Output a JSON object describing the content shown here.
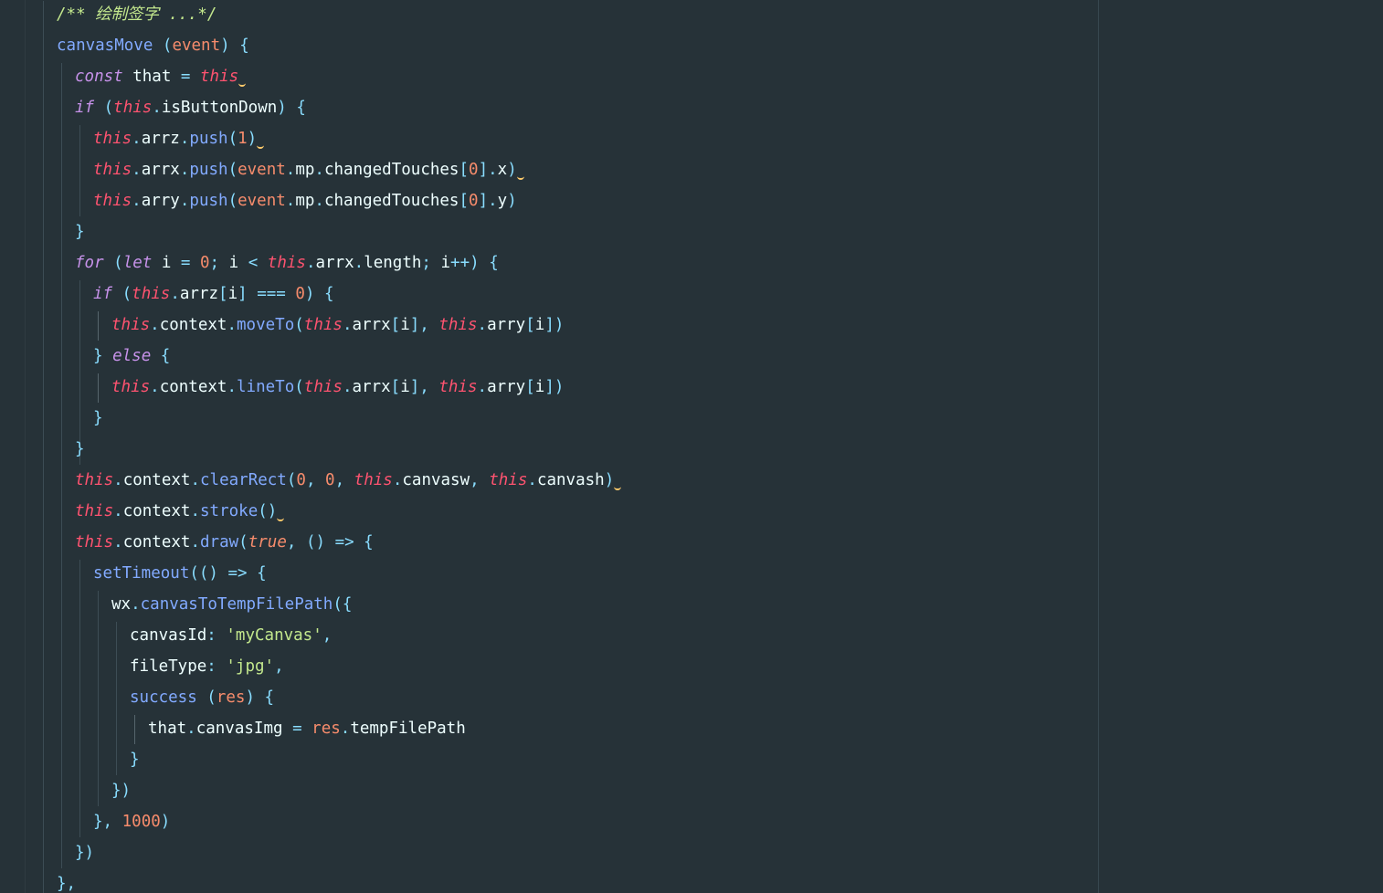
{
  "editor": {
    "lines": [
      {
        "indent": 62,
        "tokens": [
          {
            "t": "/** 绘制签字 ...*/",
            "c": "comment"
          }
        ]
      },
      {
        "indent": 62,
        "tokens": [
          {
            "t": "canvasMove",
            "c": "fn"
          },
          {
            "t": " ",
            "c": "var"
          },
          {
            "t": "(",
            "c": "punct"
          },
          {
            "t": "event",
            "c": "param"
          },
          {
            "t": ")",
            "c": "punct"
          },
          {
            "t": " {",
            "c": "punct"
          }
        ]
      },
      {
        "indent": 82,
        "tokens": [
          {
            "t": "const",
            "c": "kw"
          },
          {
            "t": " that ",
            "c": "var"
          },
          {
            "t": "=",
            "c": "punct"
          },
          {
            "t": " ",
            "c": "var"
          },
          {
            "t": "this",
            "c": "this"
          },
          {
            "t": "",
            "c": "squiggle"
          }
        ]
      },
      {
        "indent": 82,
        "tokens": [
          {
            "t": "if",
            "c": "kw"
          },
          {
            "t": " (",
            "c": "punct"
          },
          {
            "t": "this",
            "c": "this"
          },
          {
            "t": ".",
            "c": "punct"
          },
          {
            "t": "isButtonDown",
            "c": "var"
          },
          {
            "t": ")",
            "c": "punct"
          },
          {
            "t": " {",
            "c": "punct"
          }
        ]
      },
      {
        "indent": 102,
        "tokens": [
          {
            "t": "this",
            "c": "this"
          },
          {
            "t": ".",
            "c": "punct"
          },
          {
            "t": "arrz",
            "c": "var"
          },
          {
            "t": ".",
            "c": "punct"
          },
          {
            "t": "push",
            "c": "fn"
          },
          {
            "t": "(",
            "c": "punct"
          },
          {
            "t": "1",
            "c": "num"
          },
          {
            "t": ")",
            "c": "punct"
          },
          {
            "t": "",
            "c": "squiggle"
          }
        ]
      },
      {
        "indent": 102,
        "tokens": [
          {
            "t": "this",
            "c": "this"
          },
          {
            "t": ".",
            "c": "punct"
          },
          {
            "t": "arrx",
            "c": "var"
          },
          {
            "t": ".",
            "c": "punct"
          },
          {
            "t": "push",
            "c": "fn"
          },
          {
            "t": "(",
            "c": "punct"
          },
          {
            "t": "event",
            "c": "param"
          },
          {
            "t": ".",
            "c": "punct"
          },
          {
            "t": "mp",
            "c": "var"
          },
          {
            "t": ".",
            "c": "punct"
          },
          {
            "t": "changedTouches",
            "c": "var"
          },
          {
            "t": "[",
            "c": "punct"
          },
          {
            "t": "0",
            "c": "num"
          },
          {
            "t": "].",
            "c": "punct"
          },
          {
            "t": "x",
            "c": "var"
          },
          {
            "t": ")",
            "c": "punct"
          },
          {
            "t": "",
            "c": "squiggle"
          }
        ]
      },
      {
        "indent": 102,
        "tokens": [
          {
            "t": "this",
            "c": "this"
          },
          {
            "t": ".",
            "c": "punct"
          },
          {
            "t": "arry",
            "c": "var"
          },
          {
            "t": ".",
            "c": "punct"
          },
          {
            "t": "push",
            "c": "fn"
          },
          {
            "t": "(",
            "c": "punct"
          },
          {
            "t": "event",
            "c": "param"
          },
          {
            "t": ".",
            "c": "punct"
          },
          {
            "t": "mp",
            "c": "var"
          },
          {
            "t": ".",
            "c": "punct"
          },
          {
            "t": "changedTouches",
            "c": "var"
          },
          {
            "t": "[",
            "c": "punct"
          },
          {
            "t": "0",
            "c": "num"
          },
          {
            "t": "].",
            "c": "punct"
          },
          {
            "t": "y",
            "c": "var"
          },
          {
            "t": ")",
            "c": "punct"
          }
        ]
      },
      {
        "indent": 82,
        "tokens": [
          {
            "t": "}",
            "c": "punct"
          }
        ]
      },
      {
        "indent": 82,
        "tokens": [
          {
            "t": "for",
            "c": "kw"
          },
          {
            "t": " (",
            "c": "punct"
          },
          {
            "t": "let",
            "c": "kw"
          },
          {
            "t": " i ",
            "c": "var"
          },
          {
            "t": "=",
            "c": "punct"
          },
          {
            "t": " ",
            "c": "var"
          },
          {
            "t": "0",
            "c": "num"
          },
          {
            "t": ";",
            "c": "punct"
          },
          {
            "t": " i ",
            "c": "var"
          },
          {
            "t": "<",
            "c": "punct"
          },
          {
            "t": " ",
            "c": "var"
          },
          {
            "t": "this",
            "c": "this"
          },
          {
            "t": ".",
            "c": "punct"
          },
          {
            "t": "arrx",
            "c": "var"
          },
          {
            "t": ".",
            "c": "punct"
          },
          {
            "t": "length",
            "c": "var"
          },
          {
            "t": ";",
            "c": "punct"
          },
          {
            "t": " i",
            "c": "var"
          },
          {
            "t": "++",
            "c": "punct"
          },
          {
            "t": ")",
            "c": "punct"
          },
          {
            "t": " {",
            "c": "punct"
          }
        ]
      },
      {
        "indent": 102,
        "tokens": [
          {
            "t": "if",
            "c": "kw"
          },
          {
            "t": " (",
            "c": "punct"
          },
          {
            "t": "this",
            "c": "this"
          },
          {
            "t": ".",
            "c": "punct"
          },
          {
            "t": "arrz",
            "c": "var"
          },
          {
            "t": "[",
            "c": "punct"
          },
          {
            "t": "i",
            "c": "var"
          },
          {
            "t": "]",
            "c": "punct"
          },
          {
            "t": " === ",
            "c": "punct"
          },
          {
            "t": "0",
            "c": "num"
          },
          {
            "t": ")",
            "c": "punct"
          },
          {
            "t": " {",
            "c": "punct"
          }
        ]
      },
      {
        "indent": 122,
        "tokens": [
          {
            "t": "this",
            "c": "this"
          },
          {
            "t": ".",
            "c": "punct"
          },
          {
            "t": "context",
            "c": "var"
          },
          {
            "t": ".",
            "c": "punct"
          },
          {
            "t": "moveTo",
            "c": "fn"
          },
          {
            "t": "(",
            "c": "punct"
          },
          {
            "t": "this",
            "c": "this"
          },
          {
            "t": ".",
            "c": "punct"
          },
          {
            "t": "arrx",
            "c": "var"
          },
          {
            "t": "[",
            "c": "punct"
          },
          {
            "t": "i",
            "c": "var"
          },
          {
            "t": "],",
            "c": "punct"
          },
          {
            "t": " ",
            "c": "var"
          },
          {
            "t": "this",
            "c": "this"
          },
          {
            "t": ".",
            "c": "punct"
          },
          {
            "t": "arry",
            "c": "var"
          },
          {
            "t": "[",
            "c": "punct"
          },
          {
            "t": "i",
            "c": "var"
          },
          {
            "t": "])",
            "c": "punct"
          }
        ]
      },
      {
        "indent": 102,
        "tokens": [
          {
            "t": "}",
            "c": "punct"
          },
          {
            "t": " ",
            "c": "var"
          },
          {
            "t": "else",
            "c": "kw"
          },
          {
            "t": " {",
            "c": "punct"
          }
        ]
      },
      {
        "indent": 122,
        "tokens": [
          {
            "t": "this",
            "c": "this"
          },
          {
            "t": ".",
            "c": "punct"
          },
          {
            "t": "context",
            "c": "var"
          },
          {
            "t": ".",
            "c": "punct"
          },
          {
            "t": "lineTo",
            "c": "fn"
          },
          {
            "t": "(",
            "c": "punct"
          },
          {
            "t": "this",
            "c": "this"
          },
          {
            "t": ".",
            "c": "punct"
          },
          {
            "t": "arrx",
            "c": "var"
          },
          {
            "t": "[",
            "c": "punct"
          },
          {
            "t": "i",
            "c": "var"
          },
          {
            "t": "],",
            "c": "punct"
          },
          {
            "t": " ",
            "c": "var"
          },
          {
            "t": "this",
            "c": "this"
          },
          {
            "t": ".",
            "c": "punct"
          },
          {
            "t": "arry",
            "c": "var"
          },
          {
            "t": "[",
            "c": "punct"
          },
          {
            "t": "i",
            "c": "var"
          },
          {
            "t": "])",
            "c": "punct"
          }
        ]
      },
      {
        "indent": 102,
        "tokens": [
          {
            "t": "}",
            "c": "punct"
          }
        ]
      },
      {
        "indent": 82,
        "tokens": [
          {
            "t": "}",
            "c": "punct"
          }
        ]
      },
      {
        "indent": 82,
        "tokens": [
          {
            "t": "this",
            "c": "this"
          },
          {
            "t": ".",
            "c": "punct"
          },
          {
            "t": "context",
            "c": "var"
          },
          {
            "t": ".",
            "c": "punct"
          },
          {
            "t": "clearRect",
            "c": "fn"
          },
          {
            "t": "(",
            "c": "punct"
          },
          {
            "t": "0",
            "c": "num"
          },
          {
            "t": ",",
            "c": "punct"
          },
          {
            "t": " ",
            "c": "var"
          },
          {
            "t": "0",
            "c": "num"
          },
          {
            "t": ",",
            "c": "punct"
          },
          {
            "t": " ",
            "c": "var"
          },
          {
            "t": "this",
            "c": "this"
          },
          {
            "t": ".",
            "c": "punct"
          },
          {
            "t": "canvasw",
            "c": "var"
          },
          {
            "t": ",",
            "c": "punct"
          },
          {
            "t": " ",
            "c": "var"
          },
          {
            "t": "this",
            "c": "this"
          },
          {
            "t": ".",
            "c": "punct"
          },
          {
            "t": "canvash",
            "c": "var"
          },
          {
            "t": ")",
            "c": "punct"
          },
          {
            "t": "",
            "c": "squiggle"
          }
        ]
      },
      {
        "indent": 82,
        "tokens": [
          {
            "t": "this",
            "c": "this"
          },
          {
            "t": ".",
            "c": "punct"
          },
          {
            "t": "context",
            "c": "var"
          },
          {
            "t": ".",
            "c": "punct"
          },
          {
            "t": "stroke",
            "c": "fn"
          },
          {
            "t": "()",
            "c": "punct"
          },
          {
            "t": "",
            "c": "squiggle"
          }
        ]
      },
      {
        "indent": 82,
        "tokens": [
          {
            "t": "this",
            "c": "this"
          },
          {
            "t": ".",
            "c": "punct"
          },
          {
            "t": "context",
            "c": "var"
          },
          {
            "t": ".",
            "c": "punct"
          },
          {
            "t": "draw",
            "c": "fn"
          },
          {
            "t": "(",
            "c": "punct"
          },
          {
            "t": "true",
            "c": "bool"
          },
          {
            "t": ",",
            "c": "punct"
          },
          {
            "t": " () => {",
            "c": "punct"
          }
        ]
      },
      {
        "indent": 102,
        "tokens": [
          {
            "t": "setTimeout",
            "c": "fn"
          },
          {
            "t": "(() => {",
            "c": "punct"
          }
        ]
      },
      {
        "indent": 122,
        "tokens": [
          {
            "t": "wx",
            "c": "var"
          },
          {
            "t": ".",
            "c": "punct"
          },
          {
            "t": "canvasToTempFilePath",
            "c": "fn"
          },
          {
            "t": "({",
            "c": "punct"
          }
        ]
      },
      {
        "indent": 142,
        "tokens": [
          {
            "t": "canvasId",
            "c": "var"
          },
          {
            "t": ":",
            "c": "punct"
          },
          {
            "t": " ",
            "c": "var"
          },
          {
            "t": "'myCanvas'",
            "c": "str"
          },
          {
            "t": ",",
            "c": "punct"
          }
        ]
      },
      {
        "indent": 142,
        "tokens": [
          {
            "t": "fileType",
            "c": "var"
          },
          {
            "t": ":",
            "c": "punct"
          },
          {
            "t": " ",
            "c": "var"
          },
          {
            "t": "'jpg'",
            "c": "str"
          },
          {
            "t": ",",
            "c": "punct"
          }
        ]
      },
      {
        "indent": 142,
        "tokens": [
          {
            "t": "success",
            "c": "fn"
          },
          {
            "t": " (",
            "c": "punct"
          },
          {
            "t": "res",
            "c": "param"
          },
          {
            "t": ")",
            "c": "punct"
          },
          {
            "t": " {",
            "c": "punct"
          }
        ]
      },
      {
        "indent": 162,
        "tokens": [
          {
            "t": "that",
            "c": "var"
          },
          {
            "t": ".",
            "c": "punct"
          },
          {
            "t": "canvasImg ",
            "c": "var"
          },
          {
            "t": "=",
            "c": "punct"
          },
          {
            "t": " ",
            "c": "var"
          },
          {
            "t": "res",
            "c": "param"
          },
          {
            "t": ".",
            "c": "punct"
          },
          {
            "t": "tempFilePath",
            "c": "var"
          }
        ]
      },
      {
        "indent": 142,
        "tokens": [
          {
            "t": "}",
            "c": "punct"
          }
        ]
      },
      {
        "indent": 122,
        "tokens": [
          {
            "t": "})",
            "c": "punct"
          }
        ]
      },
      {
        "indent": 102,
        "tokens": [
          {
            "t": "},",
            "c": "punct"
          },
          {
            "t": " ",
            "c": "var"
          },
          {
            "t": "1000",
            "c": "num"
          },
          {
            "t": ")",
            "c": "punct"
          }
        ]
      },
      {
        "indent": 82,
        "tokens": [
          {
            "t": "})",
            "c": "punct"
          }
        ]
      },
      {
        "indent": 62,
        "tokens": [
          {
            "t": "},",
            "c": "punct"
          }
        ]
      }
    ]
  }
}
